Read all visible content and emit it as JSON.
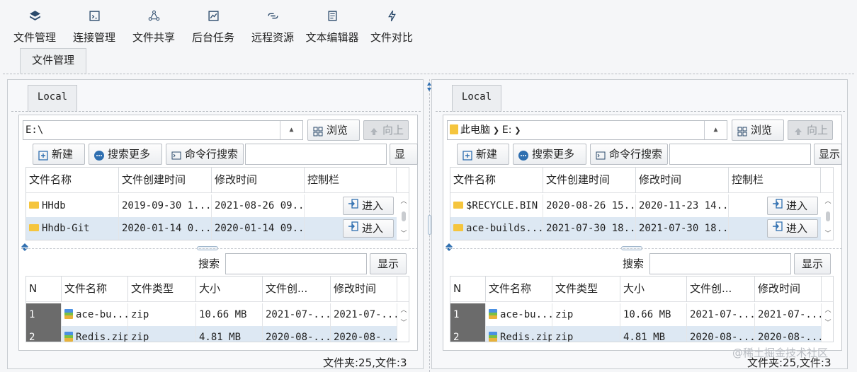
{
  "toolbar": [
    {
      "label": "文件管理",
      "icon": "layers-icon"
    },
    {
      "label": "连接管理",
      "icon": "code-window-icon"
    },
    {
      "label": "文件共享",
      "icon": "share-icon"
    },
    {
      "label": "后台任务",
      "icon": "activity-chart-icon"
    },
    {
      "label": "远程资源",
      "icon": "link-icon"
    },
    {
      "label": "文本编辑器",
      "icon": "document-icon"
    },
    {
      "label": "文件对比",
      "icon": "lightning-icon"
    }
  ],
  "outer_tab": "文件管理",
  "panes": [
    {
      "tab": "Local",
      "path": "E:\\",
      "path_crumb": null,
      "browse_label": "浏览",
      "up_label": "向上",
      "new_label": "新建",
      "search_more_label": "搜索更多",
      "cmd_search_label": "命令行搜索",
      "show_label_cut": "显",
      "columns": [
        "文件名称",
        "文件创建时间",
        "修改时间",
        "控制栏"
      ],
      "rows": [
        {
          "name": "HHdb",
          "created": "2019-09-30 1...",
          "modified": "2021-08-26 09...",
          "action": "进入"
        },
        {
          "name": "Hhdb-Git",
          "created": "2020-01-14 0...",
          "modified": "2020-01-14 09...",
          "action": "进入"
        }
      ],
      "search_label": "搜索",
      "show_label": "显示",
      "file_columns": [
        "N",
        "文件名称",
        "文件类型",
        "大小",
        "文件创...",
        "修改时间"
      ],
      "files": [
        {
          "n": "1",
          "name": "ace-bu...",
          "type": "zip",
          "size": "10.66 MB",
          "created": "2021-07-...",
          "modified": "2021-07-..."
        },
        {
          "n": "2",
          "name": "Redis.zip",
          "type": "zip",
          "size": "4.81 MB",
          "created": "2020-08-...",
          "modified": "2020-08-..."
        }
      ],
      "status": "文件夹:25,文件:3"
    },
    {
      "tab": "Local",
      "path": "",
      "path_crumb": [
        "此电脑",
        "E:"
      ],
      "browse_label": "浏览",
      "up_label": "向上",
      "new_label": "新建",
      "search_more_label": "搜索更多",
      "cmd_search_label": "命令行搜索",
      "show_label_cut": "显示",
      "columns": [
        "文件名称",
        "文件创建时间",
        "修改时间",
        "控制栏"
      ],
      "rows": [
        {
          "name": "$RECYCLE.BIN",
          "created": "2020-08-26 15...",
          "modified": "2020-11-23 14...",
          "action": "进入"
        },
        {
          "name": "ace-builds...",
          "created": "2021-07-30 18...",
          "modified": "2021-07-30 18...",
          "action": "进入"
        }
      ],
      "search_label": "搜索",
      "show_label": "显示",
      "file_columns": [
        "N",
        "文件名称",
        "文件类型",
        "大小",
        "文件创...",
        "修改时间"
      ],
      "files": [
        {
          "n": "1",
          "name": "ace-bu...",
          "type": "zip",
          "size": "10.66 MB",
          "created": "2021-07-...",
          "modified": "2021-07-..."
        },
        {
          "n": "2",
          "name": "Redis.zip",
          "type": "zip",
          "size": "4.81 MB",
          "created": "2020-08-...",
          "modified": "2020-08-..."
        }
      ],
      "status": "文件夹:25,文件:3"
    }
  ],
  "watermark": "@稀土掘金技术社区",
  "colors": {
    "accent": "#2f6fb0",
    "selected_row": "#dde8f3",
    "folder": "#f5c53d"
  }
}
